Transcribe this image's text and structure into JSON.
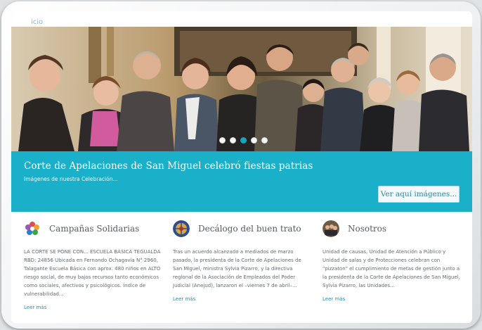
{
  "breadcrumb": "icio",
  "slider": {
    "dots": [
      false,
      false,
      true,
      false,
      false
    ]
  },
  "banner": {
    "title": "Corte de Apelaciones de San Miguel celebró fiestas patrias",
    "subtitle": "Imágenes de nuestra Celebración...",
    "button_label": "Ver aquí imágenes..."
  },
  "columns": [
    {
      "icon": "solidarity-flower-icon",
      "title": "Campañas Solidarias",
      "text": "LA CORTE SE PONE CON... ESCUELA BÁSICA TEGUALDA RBD: 24856 Ubicada en Fernando Ochagavia N° 2960, Talagante Escuela Básica con aprox. 480 niños en ALTO riesgo social, de muy bajos recursos tanto económicos como sociales, afectivos y psicológicos. Índice de vulnerabilidad...",
      "more": "Leer más"
    },
    {
      "icon": "globe-logo-icon",
      "title": "Decálogo del buen trato",
      "text": "Tras un acuerdo alcanzado a mediados de marzo pasado, la presidenta de la Corte de Apelaciones de San Miguel, ministra Sylvia Pizarro, y la directiva regional de la Asociación de Empleados del Poder Judicial (Anejud), lanzaron el –viernes 7 de abril–...",
      "more": "Leer más"
    },
    {
      "icon": "group-photo-icon",
      "title": "Nosotros",
      "text": "Unidad de causas, Unidad de Atención a Público y Unidad de salas y de Protecciones celebran con \"pizzaton\" el cumplimiento de metas de gestión junto a la presidenta de la Corte de Apelaciones de San Miguel, Sylvia Pizarro, las Unidades...",
      "more": "Leer más"
    }
  ]
}
